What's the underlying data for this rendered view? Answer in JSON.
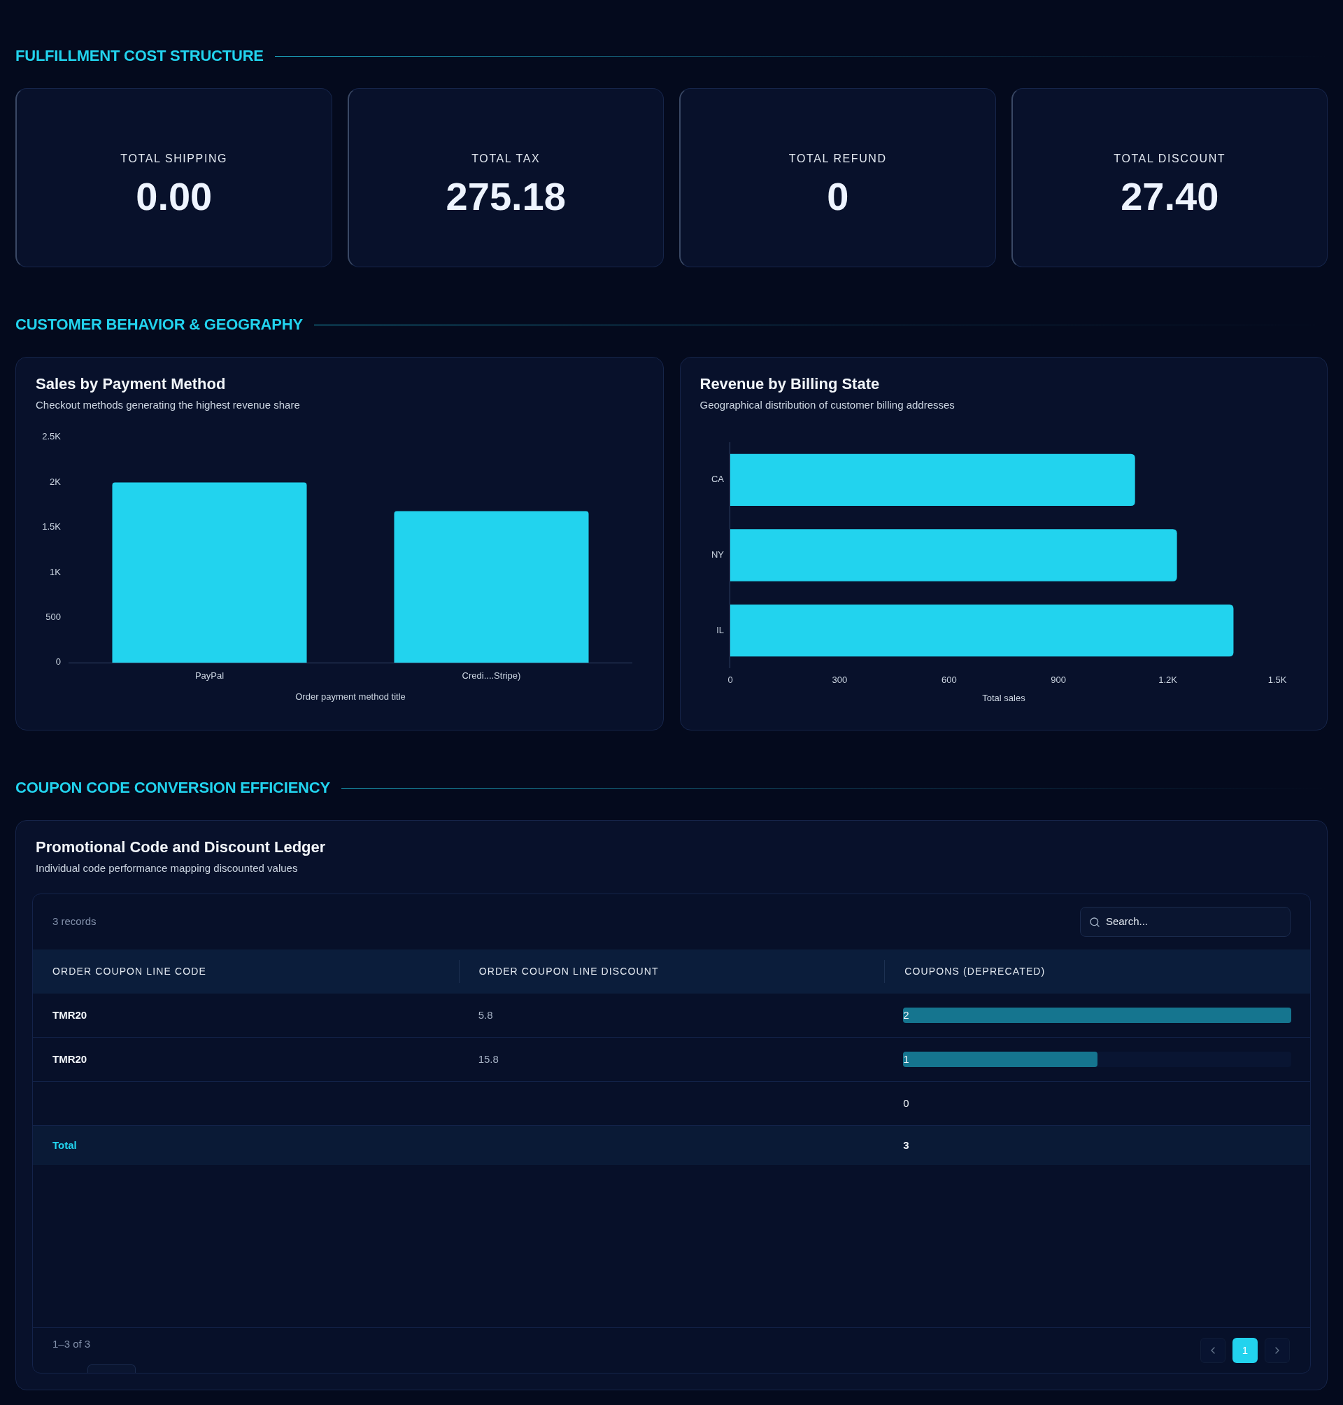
{
  "cost_section": {
    "title": "FULFILLMENT COST STRUCTURE",
    "cards": [
      {
        "label": "TOTAL SHIPPING",
        "value": "0.00"
      },
      {
        "label": "TOTAL TAX",
        "value": "275.18"
      },
      {
        "label": "TOTAL REFUND",
        "value": "0"
      },
      {
        "label": "TOTAL DISCOUNT",
        "value": "27.40"
      }
    ]
  },
  "behavior_section": {
    "title": "CUSTOMER BEHAVIOR & GEOGRAPHY",
    "panels": [
      {
        "title": "Sales by Payment Method",
        "subtitle": "Checkout methods generating the highest revenue share",
        "chart_data": {
          "type": "bar",
          "xlabel": "Order payment method title",
          "categories": [
            "PayPal",
            "Credi....Stripe)"
          ],
          "values": [
            2000,
            1680
          ],
          "ylim": [
            0,
            2500
          ],
          "yticks": [
            0,
            500,
            {
              "value": 1000,
              "label": "1K"
            },
            {
              "value": 1500,
              "label": "1.5K"
            },
            {
              "value": 2000,
              "label": "2K"
            },
            {
              "value": 2500,
              "label": "2.5K"
            }
          ]
        }
      },
      {
        "title": "Revenue by Billing State",
        "subtitle": "Geographical distribution of customer billing addresses",
        "chart_data": {
          "type": "bar",
          "orientation": "horizontal",
          "xlabel": "Total sales",
          "categories": [
            "CA",
            "NY",
            "IL"
          ],
          "values": [
            1110,
            1225,
            1380
          ],
          "xlim": [
            0,
            1500
          ],
          "xticks": [
            0,
            300,
            600,
            900,
            {
              "value": 1200,
              "label": "1.2K"
            },
            {
              "value": 1500,
              "label": "1.5K"
            }
          ]
        }
      }
    ]
  },
  "coupon_section": {
    "title": "COUPON CODE CONVERSION EFFICIENCY",
    "panel": {
      "title": "Promotional Code and Discount Ledger",
      "subtitle": "Individual code performance mapping discounted values",
      "records": "3 records",
      "search": {
        "placeholder": "Search..."
      },
      "columns": [
        "ORDER COUPON LINE CODE",
        "ORDER COUPON LINE DISCOUNT",
        "COUPONS (DEPRECATED)"
      ],
      "rows": [
        {
          "code": "TMR20",
          "discount": "5.8",
          "coupons": "2",
          "level": 1
        },
        {
          "code": "TMR20",
          "discount": "15.8",
          "coupons": "1",
          "level": 0.5
        },
        {
          "coupons": "0"
        }
      ],
      "total": {
        "label": "Total",
        "coupons": "3"
      },
      "range": "1–3 of 3",
      "pages": [
        {
          "label": "1",
          "selected": true
        }
      ]
    }
  }
}
